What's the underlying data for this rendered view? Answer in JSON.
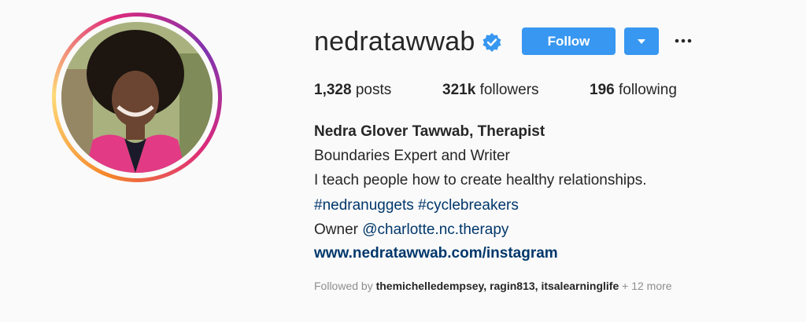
{
  "profile": {
    "username": "nedratawwab",
    "verified_icon": "verified-badge-icon",
    "follow_label": "Follow",
    "dropdown_icon": "caret-down-icon",
    "more_icon": "ellipsis-icon"
  },
  "stats": {
    "posts_count": "1,328",
    "posts_label": "posts",
    "followers_count": "321k",
    "followers_label": "followers",
    "following_count": "196",
    "following_label": "following"
  },
  "bio": {
    "name": "Nedra Glover Tawwab, Therapist",
    "line1": "Boundaries Expert and Writer",
    "line2": "I teach people how to create healthy relationships.",
    "hashtag1": "#nedranuggets",
    "hashtag2": "#cyclebreakers",
    "owner_prefix": "Owner",
    "owner_handle": "@charlotte.nc.therapy",
    "url": "www.nedratawwab.com/instagram"
  },
  "followed_by": {
    "prefix": "Followed by",
    "user1": "themichelledempsey",
    "user2": "ragin813",
    "user3": "itsalearninglife",
    "more": "+ 12 more"
  },
  "colors": {
    "accent": "#3897f0",
    "link": "#00376b",
    "muted": "#8e8e8e",
    "text": "#262626"
  }
}
